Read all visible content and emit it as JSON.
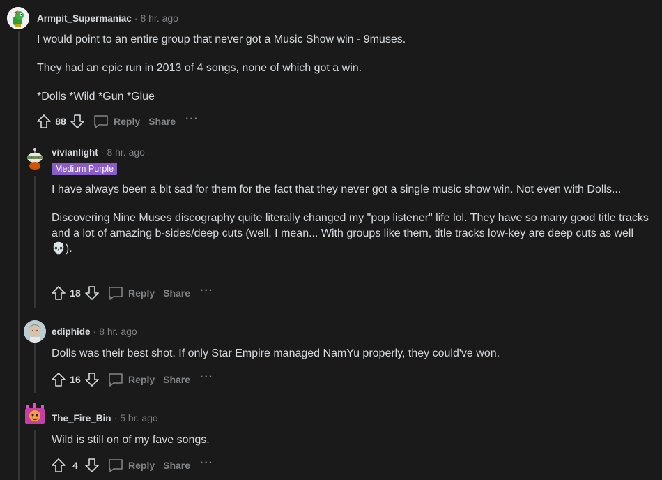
{
  "comments": [
    {
      "username": "Armpit_Supermaniac",
      "time": "8 hr. ago",
      "paragraphs": [
        "I would point to an entire group that never got a Music Show win - 9muses.",
        "They had an epic run in 2013 of 4 songs, none of which got a win.",
        "*Dolls *Wild *Gun *Glue"
      ],
      "score": "88",
      "reply_label": "Reply",
      "share_label": "Share",
      "more_label": "···"
    },
    {
      "username": "vivianlight",
      "time": "8 hr. ago",
      "flair": "Medium Purple",
      "paragraphs": [
        "I have always been a bit sad for them for the fact that they never got a single music show win. Not even with Dolls...",
        "Discovering Nine Muses discography quite literally changed my \"pop listener\" life lol. They have so many good title tracks and a lot of amazing b-sides/deep cuts (well, I mean... With groups like them, title tracks low-key are deep cuts as well 💀)."
      ],
      "score": "18",
      "reply_label": "Reply",
      "share_label": "Share",
      "more_label": "···"
    },
    {
      "username": "ediphide",
      "time": "8 hr. ago",
      "paragraphs": [
        "Dolls was their best shot. If only Star Empire managed NamYu properly, they could've won."
      ],
      "score": "16",
      "reply_label": "Reply",
      "share_label": "Share",
      "more_label": "···"
    },
    {
      "username": "The_Fire_Bin",
      "time": "5 hr. ago",
      "paragraphs": [
        "Wild is still on of my fave songs."
      ],
      "score": "4",
      "reply_label": "Reply",
      "share_label": "Share",
      "more_label": "···"
    }
  ],
  "separator": "·",
  "icons": {
    "upvote": "arrow-up-icon",
    "downvote": "arrow-down-icon",
    "reply": "speech-bubble-icon"
  },
  "colors": {
    "background": "#1a1a1b",
    "text": "#d7dadc",
    "muted": "#818384",
    "flair": "#8b5cc7",
    "thread_line": "#343536"
  }
}
